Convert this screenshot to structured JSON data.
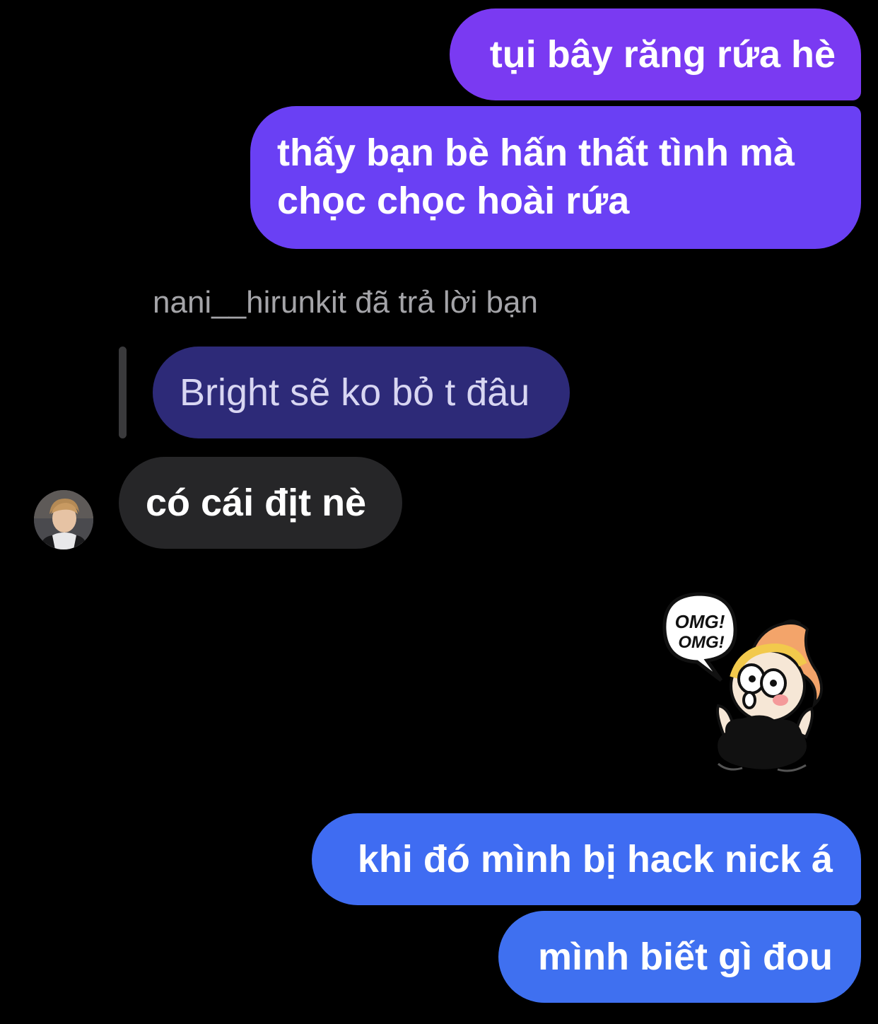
{
  "messages": {
    "sent_1": "tụi bây răng rứa hè",
    "sent_2_line_1": "thấy bạn bè hấn thất tình mà",
    "sent_2_line_2": "chọc chọc hoài rứa",
    "reply_caption": "nani__hirunkit đã trả lời bạn",
    "quoted": "Bright sẽ ko bỏ t đâu",
    "received": "có cái địt nè",
    "sent_3": "khi đó mình bị hack nick á",
    "sent_4": "mình biết gì đou"
  },
  "sticker": {
    "bubble_line_1": "OMG!",
    "bubble_line_2": "OMG!"
  },
  "colors": {
    "background": "#000000",
    "sent_purple": "#7a3af2",
    "sent_blue": "#3f6cf2",
    "quoted_bubble": "#2d2a78",
    "received_bubble": "#262628",
    "caption_gray": "#a4a4a8"
  },
  "icons": {
    "avatar": "profile-photo",
    "sticker": "omg-girl-sticker"
  }
}
